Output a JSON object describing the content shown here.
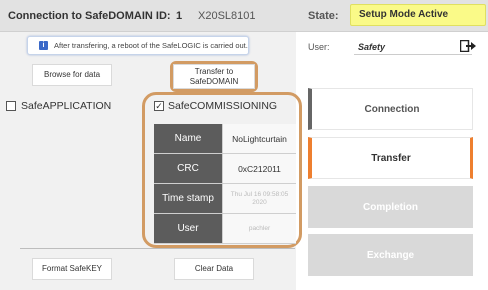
{
  "header": {
    "connection_label": "Connection to SafeDOMAIN ID:",
    "domain_number": "1",
    "device_id": "X20SL8101",
    "state_label": "State:",
    "state_value": "Setup Mode Active"
  },
  "info_banner": {
    "icon": "i",
    "text": "After transfering, a reboot of the SafeLOGIC is carried out."
  },
  "buttons": {
    "browse": "Browse for data",
    "transfer": "Transfer to SafeDOMAIN",
    "format": "Format SafeKEY",
    "clear": "Clear Data"
  },
  "checks": {
    "safe_application": {
      "label": "SafeAPPLICATION",
      "checked": false,
      "mark": ""
    },
    "safe_commissioning": {
      "label": "SafeCOMMISSIONING",
      "checked": true,
      "mark": "✓"
    }
  },
  "table": [
    {
      "key": "Name",
      "value": "NoLightcurtain"
    },
    {
      "key": "CRC",
      "value": "0xC212011"
    },
    {
      "key": "Time stamp",
      "value": "Thu Jul 16 09:58:05 2020"
    },
    {
      "key": "User",
      "value": "pachler"
    }
  ],
  "user": {
    "label": "User:",
    "value": "Safety",
    "logout_icon": "logout-icon"
  },
  "workflow": {
    "connection": "Connection",
    "transfer": "Transfer",
    "completion": "Completion",
    "exchange": "Exchange"
  },
  "colors": {
    "accent_orange": "#ee7f2f",
    "highlight_frame": "#d29b63",
    "state_yellow": "#fafa88",
    "info_blue": "#3a68c8",
    "table_key_bg": "#5c5c5c"
  }
}
